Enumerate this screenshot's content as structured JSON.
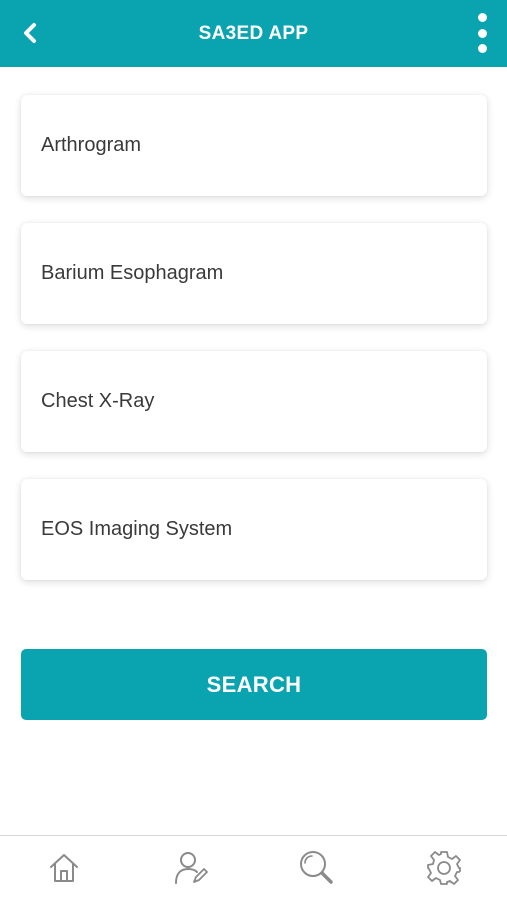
{
  "header": {
    "title": "SA3ED APP",
    "back_icon": "chevron-left-icon",
    "menu_icon": "more-vertical-icon"
  },
  "items": [
    {
      "label": "Arthrogram"
    },
    {
      "label": "Barium Esophagram"
    },
    {
      "label": "Chest X-Ray"
    },
    {
      "label": "EOS Imaging System"
    }
  ],
  "search_button": {
    "label": "SEARCH"
  },
  "bottom_nav": {
    "items": [
      {
        "icon": "home-icon"
      },
      {
        "icon": "user-edit-icon"
      },
      {
        "icon": "search-icon"
      },
      {
        "icon": "gear-icon"
      }
    ]
  },
  "colors": {
    "primary": "#0aa4b1",
    "text": "#3a3a3a",
    "icon": "#8a8a8a"
  }
}
